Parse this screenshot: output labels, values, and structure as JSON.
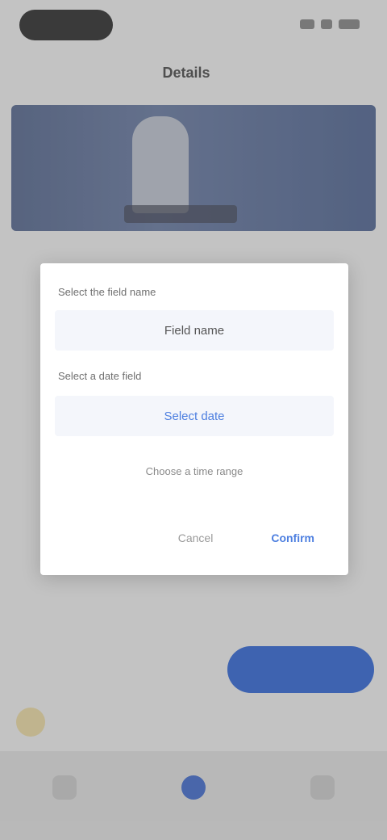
{
  "header": {
    "title": "Details",
    "aside": ""
  },
  "hero": {
    "caption": ""
  },
  "cta": {
    "label": ""
  },
  "info": {
    "title": "",
    "subtitle": ""
  },
  "tabs": [
    {
      "label": "",
      "icon": "home-icon",
      "active": false
    },
    {
      "label": "",
      "icon": "center-icon",
      "active": true
    },
    {
      "label": "",
      "icon": "profile-icon",
      "active": false
    }
  ],
  "dialog": {
    "field1_label": "Select the field name",
    "field1_value": "Field name",
    "field2_label": "Select a date field",
    "field2_value": "Select date",
    "note": "Choose a time range",
    "cancel_label": "Cancel",
    "confirm_label": "Confirm"
  },
  "colors": {
    "accent": "#4d7fe0",
    "cta": "#3f6fd1",
    "hero": "#6676a0"
  }
}
